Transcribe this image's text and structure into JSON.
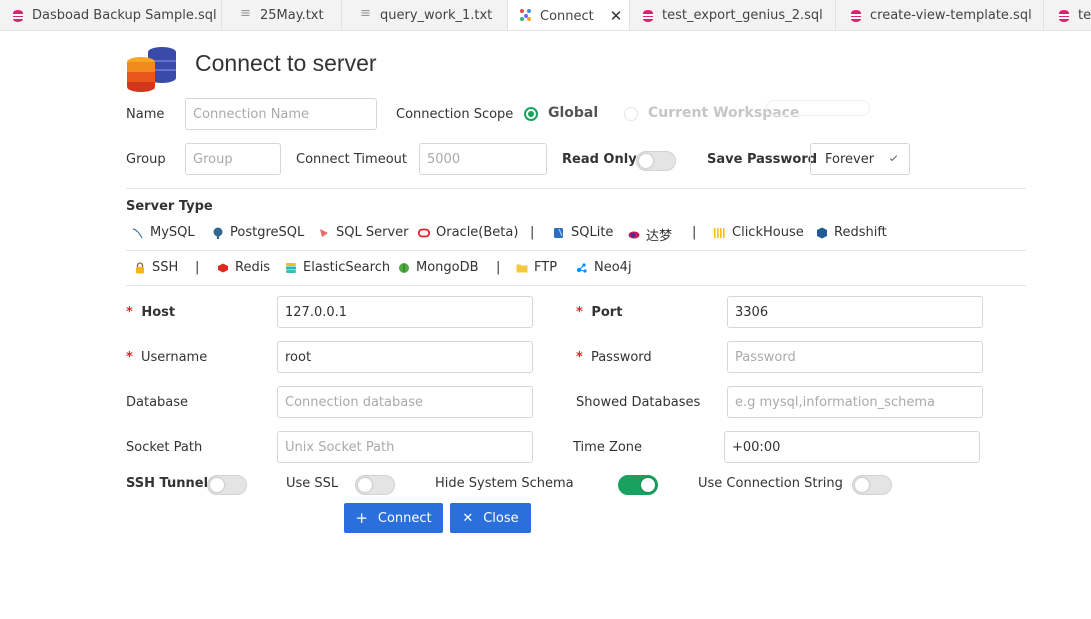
{
  "tabs": [
    {
      "label": "Dasboad Backup Sample.sql",
      "icon": "database-icon",
      "active": false
    },
    {
      "label": "25May.txt",
      "icon": "text-file-icon",
      "active": false
    },
    {
      "label": "query_work_1.txt",
      "icon": "text-file-icon",
      "active": false
    },
    {
      "label": "Connect",
      "icon": "connect-icon",
      "active": true,
      "close": "✕"
    },
    {
      "label": "test_export_genius_2.sql",
      "icon": "database-icon",
      "active": false
    },
    {
      "label": "create-view-template.sql",
      "icon": "database-icon",
      "active": false
    },
    {
      "label": "tes",
      "icon": "database-icon",
      "active": false
    }
  ],
  "header": {
    "title": "Connect to server",
    "logo": "database-stack-icon"
  },
  "form": {
    "name_label": "Name",
    "name_placeholder": "Connection Name",
    "scope_label": "Connection Scope",
    "scope_global": "Global",
    "scope_workspace": "Current Workspace",
    "group_label": "Group",
    "group_placeholder": "Group",
    "timeout_label": "Connect Timeout",
    "timeout_placeholder": "5000",
    "readonly_label": "Read Only",
    "savepwd_label": "Save Password",
    "savepwd_value": "Forever",
    "server_type_label": "Server Type",
    "host_label": "Host",
    "host_value": "127.0.0.1",
    "port_label": "Port",
    "port_value": "3306",
    "username_label": "Username",
    "username_value": "root",
    "password_label": "Password",
    "password_placeholder": "Password",
    "database_label": "Database",
    "database_placeholder": "Connection database",
    "showdb_label": "Showed Databases",
    "showdb_placeholder": "e.g mysql,information_schema",
    "socket_label": "Socket Path",
    "socket_placeholder": "Unix Socket Path",
    "timezone_label": "Time Zone",
    "timezone_value": "+00:00",
    "ssh_tunnel_label": "SSH Tunnel",
    "use_ssl_label": "Use SSL",
    "hide_schema_label": "Hide System Schema",
    "conn_string_label": "Use Connection String",
    "required_mark": "*",
    "separator": "|"
  },
  "toggles": {
    "read_only": false,
    "ssh_tunnel": false,
    "use_ssl": false,
    "hide_system_schema": true,
    "use_connection_string": false
  },
  "server_types_row1": [
    {
      "label": "MySQL",
      "icon": "mysql-icon",
      "selected": true
    },
    {
      "label": "PostgreSQL",
      "icon": "postgresql-icon"
    },
    {
      "label": "SQL Server",
      "icon": "sqlserver-icon"
    },
    {
      "label": "Oracle(Beta)",
      "icon": "oracle-icon"
    },
    {
      "label": "SQLite",
      "icon": "sqlite-icon"
    },
    {
      "label": "达梦",
      "icon": "dameng-icon"
    },
    {
      "label": "ClickHouse",
      "icon": "clickhouse-icon"
    },
    {
      "label": "Redshift",
      "icon": "redshift-icon"
    }
  ],
  "server_types_row2": [
    {
      "label": "SSH",
      "icon": "lock-icon"
    },
    {
      "label": "Redis",
      "icon": "redis-icon"
    },
    {
      "label": "ElasticSearch",
      "icon": "elasticsearch-icon"
    },
    {
      "label": "MongoDB",
      "icon": "mongodb-icon"
    },
    {
      "label": "FTP",
      "icon": "folder-icon"
    },
    {
      "label": "Neo4j",
      "icon": "neo4j-icon"
    }
  ],
  "buttons": {
    "connect": "Connect",
    "close": "Close"
  },
  "colors": {
    "accent": "#2a6fdb",
    "toggle_on": "#19a25e",
    "required": "#e0242b",
    "tab_db_icon": "#d6246e"
  }
}
